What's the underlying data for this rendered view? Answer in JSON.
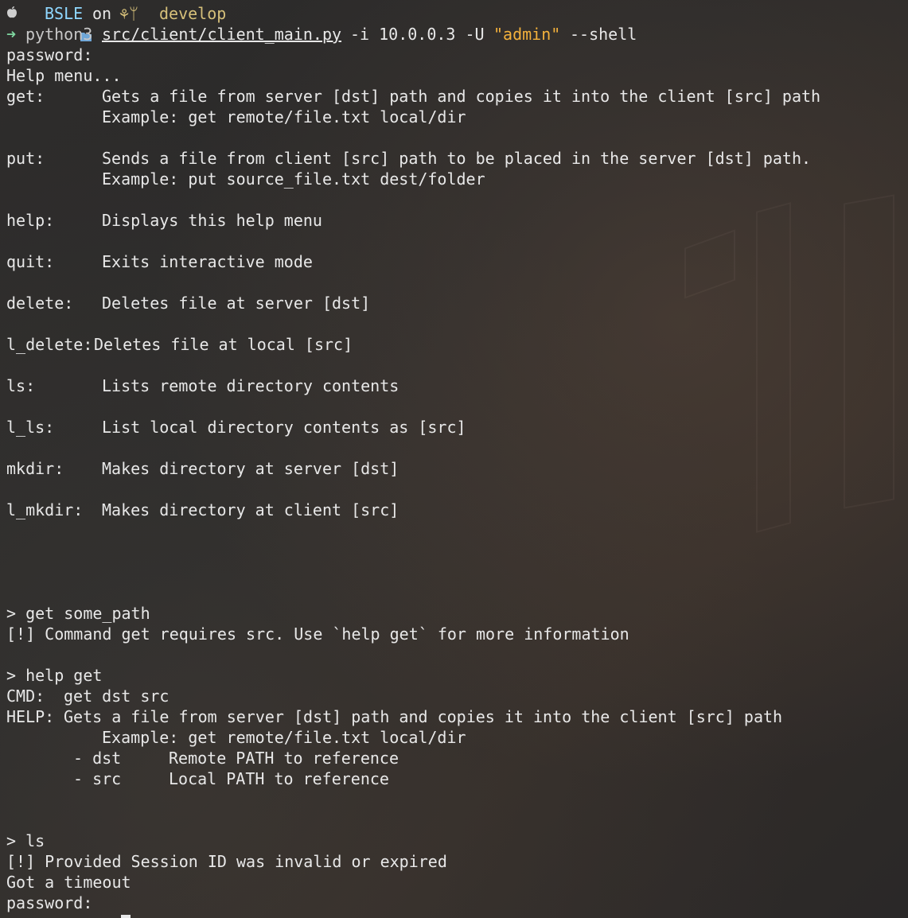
{
  "prompt": {
    "apple_icon": "apple-icon",
    "folder_icon": "folder-icon",
    "directory": "BSLE",
    "on_word": "on",
    "branch_icons": "⚘ᛘ",
    "branch": "develop",
    "arrow": "➜",
    "command_prog": "python3",
    "command_path": "src/client/client_main.py",
    "command_args_1": "-i 10.0.0.3 -U",
    "command_quoted": "\"admin\"",
    "command_args_2": "--shell"
  },
  "login": {
    "password_prompt": "password:",
    "help_title": "Help menu..."
  },
  "help_entries": [
    {
      "cmd": "get:",
      "desc": "Gets a file from server [dst] path and copies it into the client [src] path",
      "example": "Example: get remote/file.txt local/dir"
    },
    {
      "cmd": "put:",
      "desc": "Sends a file from client [src] path to be placed in the server [dst] path.",
      "example": "Example: put source_file.txt dest/folder"
    },
    {
      "cmd": "help:",
      "desc": "Displays this help menu"
    },
    {
      "cmd": "quit:",
      "desc": "Exits interactive mode"
    },
    {
      "cmd": "delete:",
      "desc": "Deletes file at server [dst]"
    },
    {
      "cmd": "l_delete:",
      "desc": "Deletes file at local [src]"
    },
    {
      "cmd": "ls:",
      "desc": "Lists remote directory contents"
    },
    {
      "cmd": "l_ls:",
      "desc": "List local directory contents as [src]"
    },
    {
      "cmd": "mkdir:",
      "desc": "Makes directory at server [dst]"
    },
    {
      "cmd": "l_mkdir:",
      "desc": "Makes directory at client [src]"
    }
  ],
  "session": {
    "input1": "> get some_path",
    "error1": "[!] Command get requires src. Use `help get` for more information",
    "input2": "> help get",
    "cmd_label": "CMD:",
    "cmd_value": "get dst src",
    "help_label": "HELP:",
    "help_value": "Gets a file from server [dst] path and copies it into the client [src] path",
    "help_example": "Example: get remote/file.txt local/dir",
    "arg1_name": "- dst",
    "arg1_desc": "Remote PATH to reference",
    "arg2_name": "- src",
    "arg2_desc": "Local PATH to reference",
    "input3": "> ls",
    "error2": "[!] Provided Session ID was invalid or expired",
    "timeout": "Got a timeout",
    "password_prompt": "password:"
  }
}
